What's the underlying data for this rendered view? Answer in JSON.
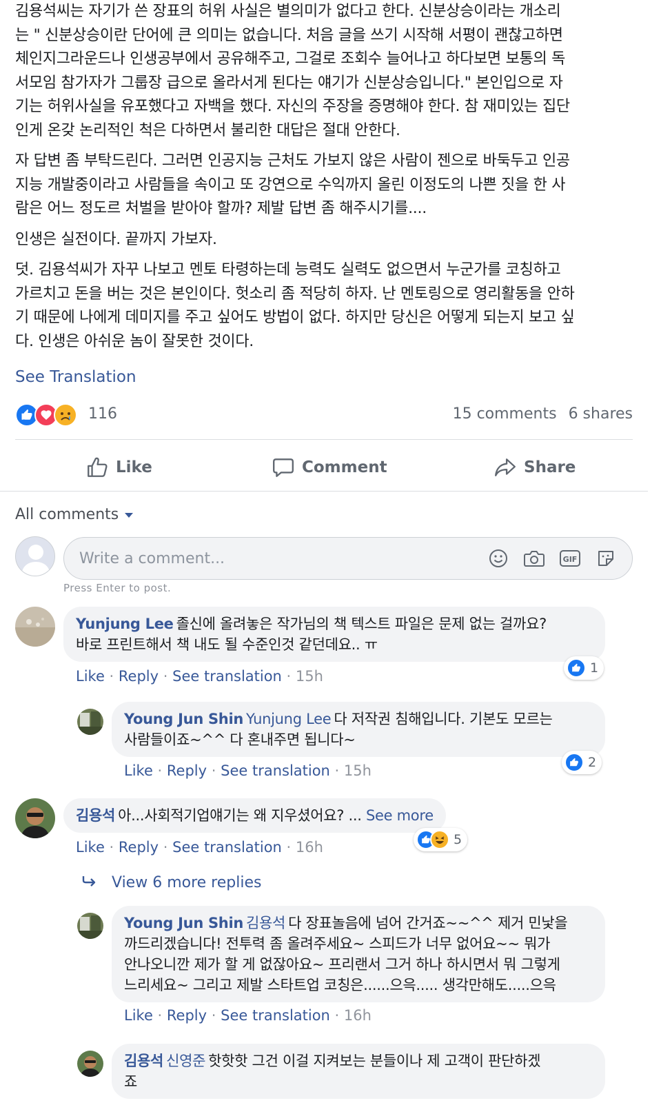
{
  "post": {
    "paragraphs": [
      [
        "김용석씨는 자기가 쓴 장표의 허위 사실은 별의미가 없다고 한다. 신분상승이라는 개소리",
        "는 \" 신분상승이란 단어에 큰 의미는 없습니다. 처음 글을 쓰기 시작해 서평이 괜찮고하면",
        "체인지그라운드나 인생공부에서 공유해주고, 그걸로 조회수 늘어나고 하다보면 보통의 독",
        "서모임 참가자가 그룹장 급으로 올라서게 된다는 얘기가 신분상승입니다.\" 본인입으로 자",
        "기는 허위사실을 유포했다고 자백을 했다. 자신의 주장을 증명해야 한다. 참 재미있는 집단",
        "인게 온갖 논리적인 척은 다하면서 불리한 대답은 절대 안한다."
      ],
      [
        "자 답변 좀 부탁드린다. 그러면 인공지능 근처도 가보지 않은 사람이 젠으로 바둑두고 인공",
        "지능 개발중이라고 사람들을 속이고 또 강연으로 수익까지 올린 이정도의 나쁜 짓을 한 사",
        "람은 어느 정도르 처벌을 받아야 할까? 제발 답변 좀 해주시기를...."
      ],
      [
        "인생은 실전이다. 끝까지 가보자."
      ],
      [
        "덧. 김용석씨가 자꾸 나보고 멘토 타령하는데 능력도 실력도 없으면서 누군가를 코칭하고",
        "가르치고 돈을 버는 것은 본인이다. 헛소리 좀 적당히 하자. 난 멘토링으로 영리활동을 안하",
        "기 때문에 나에게 데미지를 주고 싶어도 방법이 없다. 하지만 당신은 어떻게 되는지 보고 싶",
        "다. 인생은 아쉬운 놈이 잘못한 것이다."
      ]
    ],
    "see_translation": "See Translation",
    "reaction_count": "116",
    "comments_count": "15 comments",
    "shares_count": "6 shares"
  },
  "actions": {
    "like": "Like",
    "comment": "Comment",
    "share": "Share"
  },
  "comments_header": "All comments",
  "composer": {
    "placeholder": "Write a comment...",
    "hint": "Press Enter to post."
  },
  "comments": [
    {
      "author": "Yunjung Lee",
      "lines": [
        "졸신에 올려놓은 작가님의 책 텍스트 파일은 문제 없는 걸까요?",
        "바로 프린트해서 책 내도 될 수준인것 같던데요.. ㅠ"
      ],
      "like": "Like",
      "reply": "Reply",
      "translate": "See translation",
      "time": "15h",
      "reactions": "1"
    },
    {
      "author": "Young Jun Shin",
      "mention": "Yunjung Lee",
      "lines": [
        "다 저작권 침해입니다. 기본도 모르는",
        "사람들이죠~^^ 다 혼내주면 됩니다~"
      ],
      "like": "Like",
      "reply": "Reply",
      "translate": "See translation",
      "time": "15h",
      "reactions": "2"
    },
    {
      "author": "김용석",
      "text": "아...사회적기업얘기는 왜 지우셨어요? ...",
      "see_more": "See more",
      "like": "Like",
      "reply": "Reply",
      "translate": "See translation",
      "time": "16h",
      "reactions": "5"
    },
    {
      "author": "Young Jun Shin",
      "mention": "김용석",
      "lines": [
        "다 장표놀음에 넘어 간거죠~~^^ 제거 민낯을",
        "까드리겠습니다! 전투력 좀 올려주세요~ 스피드가 너무 없어요~~ 뭐가",
        "안나오니깐 제가 할 게 없잖아요~ 프리랜서 그거 하나 하시면서 뭐 그렇게",
        "느리세요~ 그리고 제발 스타트업 코칭은......으윽..... 생각만해도.....으윽"
      ],
      "like": "Like",
      "reply": "Reply",
      "translate": "See translation",
      "time": "16h"
    },
    {
      "author": "김용석",
      "mention": "신영준",
      "lines": [
        "핫핫핫 그건 이걸 지켜보는 분들이나 제 고객이 판단하겠",
        "죠"
      ]
    }
  ],
  "view_more_replies": "View 6 more replies",
  "colors": {
    "link": "#385898",
    "text": "#1c1e21",
    "muted": "#606770",
    "bubble": "#f2f3f5",
    "like_blue": "#1877f2"
  }
}
